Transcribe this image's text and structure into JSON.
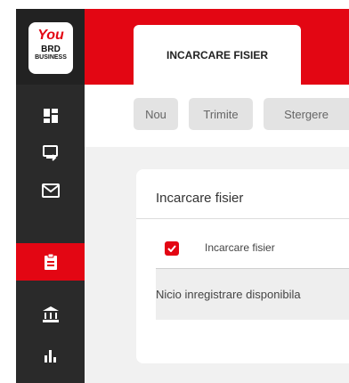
{
  "logo": {
    "line1": "You",
    "line2": "BRD",
    "line3": "BUSINESS"
  },
  "sidebar": {
    "items": [
      {
        "icon": "dashboard-icon"
      },
      {
        "icon": "transfer-icon"
      },
      {
        "icon": "mail-icon"
      },
      {
        "icon": "clipboard-icon",
        "active": true
      },
      {
        "icon": "bank-icon"
      },
      {
        "icon": "bar-chart-icon"
      }
    ]
  },
  "header": {
    "active_tab": "INCARCARE FISIER"
  },
  "toolbar": {
    "new_label": "Nou",
    "send_label": "Trimite",
    "delete_label": "Stergere"
  },
  "card": {
    "title": "Incarcare fisier",
    "table": {
      "column_header": "Incarcare fisier",
      "empty_message": "Nicio inregistrare disponibila"
    }
  },
  "colors": {
    "accent": "#e30613",
    "sidebar": "#2a2a2a"
  }
}
